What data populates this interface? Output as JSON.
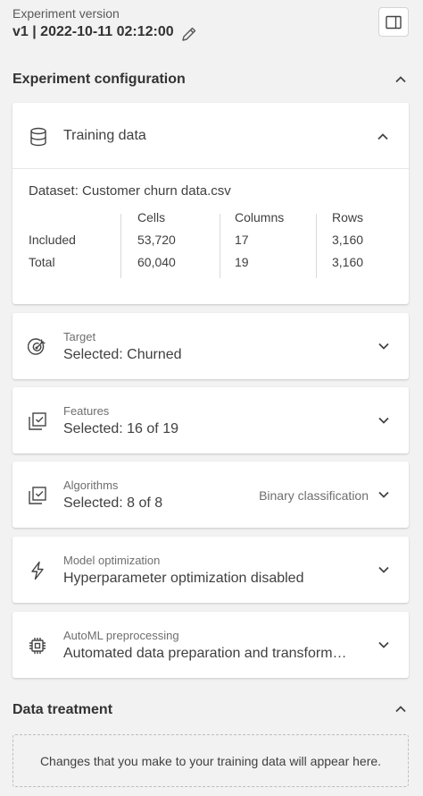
{
  "header": {
    "version_label": "Experiment version",
    "version_value": "v1 | 2022-10-11 02:12:00"
  },
  "config": {
    "title": "Experiment configuration",
    "training_data": {
      "title": "Training data",
      "dataset": "Dataset: Customer churn data.csv",
      "columns": [
        "Cells",
        "Columns",
        "Rows"
      ],
      "rows": [
        {
          "label": "Included",
          "values": [
            "53,720",
            "17",
            "3,160"
          ]
        },
        {
          "label": "Total",
          "values": [
            "60,040",
            "19",
            "3,160"
          ]
        }
      ]
    },
    "target": {
      "label": "Target",
      "value": "Selected: Churned"
    },
    "features": {
      "label": "Features",
      "value": "Selected: 16 of 19"
    },
    "algorithms": {
      "label": "Algorithms",
      "value": "Selected: 8 of 8",
      "type": "Binary classification"
    },
    "optimization": {
      "label": "Model optimization",
      "value": "Hyperparameter optimization disabled"
    },
    "preprocessing": {
      "label": "AutoML preprocessing",
      "value": "Automated data preparation and transform…"
    }
  },
  "data_treatment": {
    "title": "Data treatment",
    "empty_message": "Changes that you make to your training data will appear here."
  }
}
